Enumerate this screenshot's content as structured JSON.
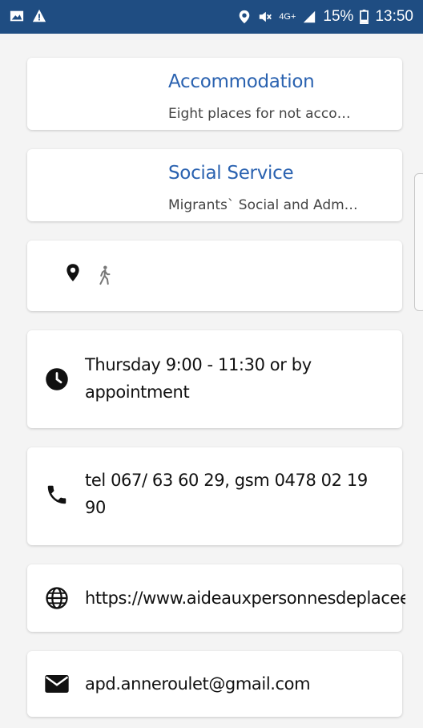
{
  "status_bar": {
    "network": "4G+",
    "battery": "15%",
    "time": "13:50",
    "background_color": "#1f4d82"
  },
  "categories": [
    {
      "title": "Accommodation",
      "subtitle": "Eight places for not acco…"
    },
    {
      "title": "Social Service",
      "subtitle": "Migrants` Social and Adm…"
    }
  ],
  "info": {
    "hours": "Thursday 9:00 - 11:30 or by appointment",
    "phone": "tel 067/ 63 60 29, gsm 0478 02 19 90",
    "website": "https://www.aideauxpersonnesdeplacee",
    "email": "apd.anneroulet@gmail.com"
  },
  "colors": {
    "accent": "#2a62b0",
    "card": "#ffffff",
    "background": "#f4f4f4"
  }
}
